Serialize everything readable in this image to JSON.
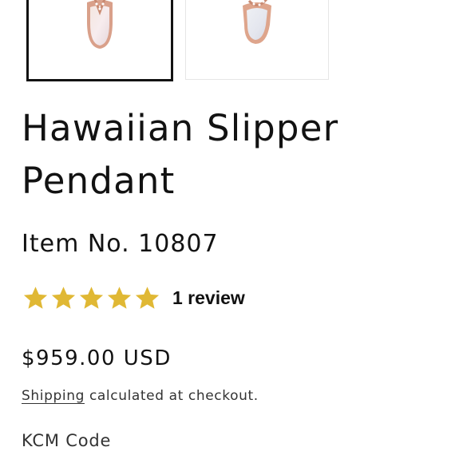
{
  "gallery": {
    "thumbnails": [
      {
        "alt": "pendant-front-icon",
        "selected": true
      },
      {
        "alt": "pendant-angle-icon",
        "selected": false
      }
    ]
  },
  "product": {
    "title": "Hawaiian Slipper Pendant",
    "item_number": "Item No. 10807",
    "rating": {
      "stars": 5,
      "star_color": "#e0b834",
      "review_label": "1 review"
    },
    "price": "$959.00 USD",
    "shipping": {
      "link_label": "Shipping",
      "note": " calculated at checkout."
    },
    "option_label": "KCM Code"
  }
}
